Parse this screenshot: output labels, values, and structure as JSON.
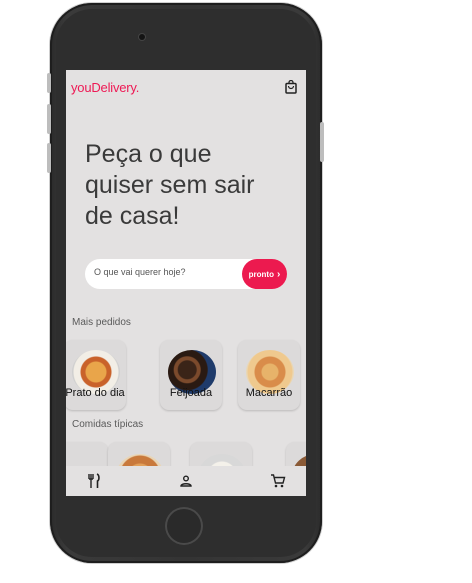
{
  "app": {
    "logo": "youDelivery."
  },
  "hero": {
    "headline": "Peça o que quiser sem sair de casa!"
  },
  "search": {
    "placeholder": "O que vai querer hoje?",
    "button_label": "pronto"
  },
  "sections": {
    "popular": {
      "title": "Mais pedidos",
      "items": [
        {
          "label": "Prato do dia"
        },
        {
          "label": "Feijoada"
        },
        {
          "label": "Macarrão"
        }
      ]
    },
    "typical": {
      "title": "Comidas típicas"
    }
  },
  "icons": {
    "bag": "shopping-bag-icon",
    "restaurant": "restaurant-icon",
    "profile": "person-icon",
    "cart": "cart-icon"
  },
  "colors": {
    "brand": "#ee1a55",
    "button": "#ec1a4f",
    "screen_bg": "#e3e1e1"
  }
}
